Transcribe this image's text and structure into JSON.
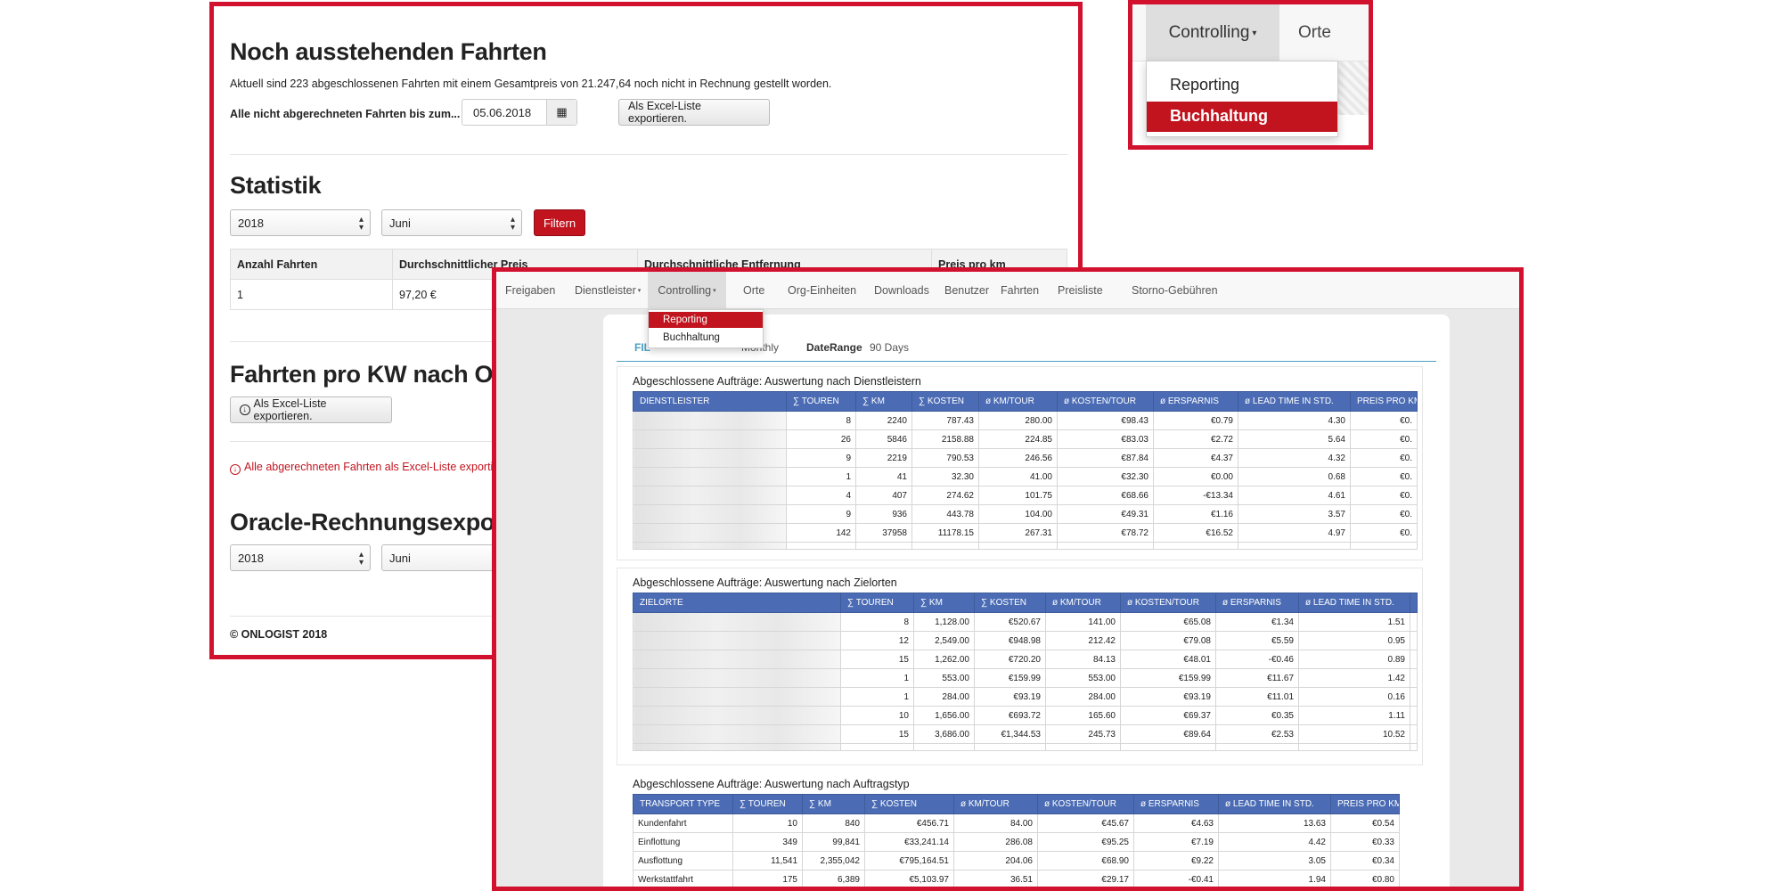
{
  "pending": {
    "title": "Noch ausstehenden Fahrten",
    "description": "Aktuell sind 223 abgeschlossenen Fahrten mit einem Gesamtpreis von 21.247,64 noch nicht in Rechnung gestellt worden.",
    "date_label": "Alle nicht abgerechneten Fahrten bis zum...",
    "date_value": "05.06.2018",
    "export_button": "Als Excel-Liste exportieren."
  },
  "statistik": {
    "title": "Statistik",
    "year": "2018",
    "month": "Juni",
    "filter_button": "Filtern",
    "headers": [
      "Anzahl Fahrten",
      "Durchschnittlicher Preis",
      "Durchschnittliche Entfernung",
      "Preis pro km"
    ],
    "row": [
      "1",
      "97,20 €",
      "",
      ""
    ]
  },
  "kw_section": {
    "title": "Fahrten pro KW nach Org",
    "export_button": "Als Excel-Liste exportieren."
  },
  "alle_link": "Alle abgerechneten Fahrten als Excel-Liste exportieren",
  "oracle": {
    "title": "Oracle-Rechnungsexport",
    "year": "2018",
    "month": "Juni"
  },
  "footer": "© ONLOGIST 2018",
  "zoom_nav": {
    "controlling": "Controlling",
    "orte": "Orte",
    "more": "(",
    "menu_items": [
      "Reporting",
      "Buchhaltung"
    ]
  },
  "reporting": {
    "nav": [
      "Freigaben",
      "Dienstleister",
      "Controlling",
      "Orte",
      "Org-Einheiten",
      "Downloads",
      "Benutzer",
      "Fahrten",
      "Preisliste",
      "Storno-Gebühren"
    ],
    "dropdown": [
      "Reporting",
      "Buchhaltung"
    ],
    "filter": {
      "label": "FIL",
      "interval": "Monthly",
      "range_label": "DateRange",
      "range_value": "90 Days"
    },
    "table1": {
      "title": "Abgeschlossene Aufträge: Auswertung nach Dienstleistern",
      "headers": [
        "DIENSTLEISTER",
        "∑ TOUREN",
        "∑ KM",
        "∑ KOSTEN",
        "ø KM/TOUR",
        "ø KOSTEN/TOUR",
        "ø ERSPARNIS",
        "ø LEAD TIME IN STD.",
        "PREIS PRO KM"
      ],
      "rows": [
        [
          "",
          "8",
          "2240",
          "787.43",
          "280.00",
          "€98.43",
          "€0.79",
          "4.30",
          "€0."
        ],
        [
          "",
          "26",
          "5846",
          "2158.88",
          "224.85",
          "€83.03",
          "€2.72",
          "5.64",
          "€0."
        ],
        [
          "",
          "9",
          "2219",
          "790.53",
          "246.56",
          "€87.84",
          "€4.37",
          "4.32",
          "€0."
        ],
        [
          "",
          "1",
          "41",
          "32.30",
          "41.00",
          "€32.30",
          "€0.00",
          "0.68",
          "€0."
        ],
        [
          "",
          "4",
          "407",
          "274.62",
          "101.75",
          "€68.66",
          "-€13.34",
          "4.61",
          "€0."
        ],
        [
          "",
          "9",
          "936",
          "443.78",
          "104.00",
          "€49.31",
          "€1.16",
          "3.57",
          "€0."
        ],
        [
          "",
          "142",
          "37958",
          "11178.15",
          "267.31",
          "€78.72",
          "€16.52",
          "4.97",
          "€0."
        ]
      ]
    },
    "table2": {
      "title": "Abgeschlossene Aufträge: Auswertung nach Zielorten",
      "headers": [
        "ZIELORTE",
        "∑ TOUREN",
        "∑ KM",
        "∑ KOSTEN",
        "ø KM/TOUR",
        "ø KOSTEN/TOUR",
        "ø ERSPARNIS",
        "ø LEAD TIME IN STD.",
        "P"
      ],
      "rows": [
        [
          "",
          "8",
          "1,128.00",
          "€520.67",
          "141.00",
          "€65.08",
          "€1.34",
          "1.51",
          ""
        ],
        [
          "",
          "12",
          "2,549.00",
          "€948.98",
          "212.42",
          "€79.08",
          "€5.59",
          "0.95",
          ""
        ],
        [
          "",
          "15",
          "1,262.00",
          "€720.20",
          "84.13",
          "€48.01",
          "-€0.46",
          "0.89",
          ""
        ],
        [
          "",
          "1",
          "553.00",
          "€159.99",
          "553.00",
          "€159.99",
          "€11.67",
          "1.42",
          ""
        ],
        [
          "",
          "1",
          "284.00",
          "€93.19",
          "284.00",
          "€93.19",
          "€11.01",
          "0.16",
          ""
        ],
        [
          "",
          "10",
          "1,656.00",
          "€693.72",
          "165.60",
          "€69.37",
          "€0.35",
          "1.11",
          ""
        ],
        [
          "",
          "15",
          "3,686.00",
          "€1,344.53",
          "245.73",
          "€89.64",
          "€2.53",
          "10.52",
          ""
        ]
      ]
    },
    "table3": {
      "title": "Abgeschlossene Aufträge: Auswertung nach Auftragstyp",
      "headers": [
        "TRANSPORT TYPE",
        "∑ TOUREN",
        "∑ KM",
        "∑ KOSTEN",
        "ø KM/TOUR",
        "ø KOSTEN/TOUR",
        "ø ERSPARNIS",
        "ø LEAD TIME IN STD.",
        "PREIS PRO KM"
      ],
      "rows": [
        [
          "Kundenfahrt",
          "10",
          "840",
          "€456.71",
          "84.00",
          "€45.67",
          "€4.63",
          "13.63",
          "€0.54"
        ],
        [
          "Einflottung",
          "349",
          "99,841",
          "€33,241.14",
          "286.08",
          "€95.25",
          "€7.19",
          "4.42",
          "€0.33"
        ],
        [
          "Ausflottung",
          "11,541",
          "2,355,042",
          "€795,164.51",
          "204.06",
          "€68.90",
          "€9.22",
          "3.05",
          "€0.34"
        ],
        [
          "Werkstattfahrt",
          "175",
          "6,389",
          "€5,103.97",
          "36.51",
          "€29.17",
          "-€0.41",
          "1.94",
          "€0.80"
        ]
      ]
    }
  }
}
